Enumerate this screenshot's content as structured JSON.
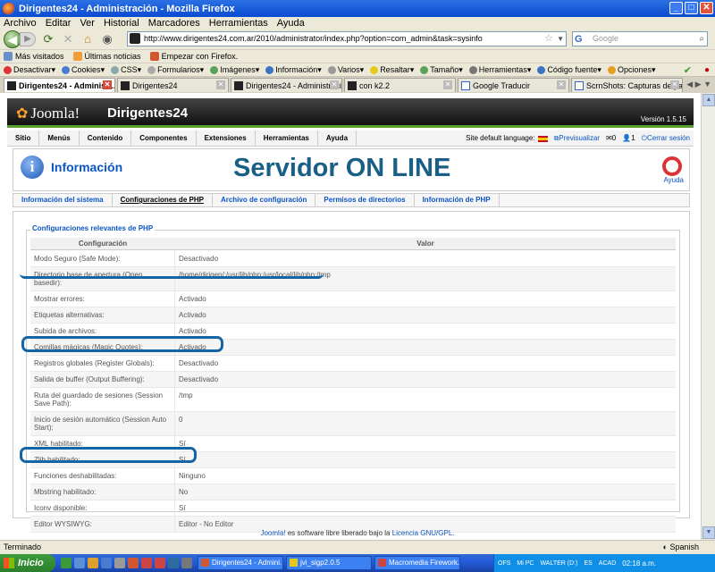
{
  "window": {
    "title": "Dirigentes24 - Administración - Mozilla Firefox"
  },
  "menubar": [
    "Archivo",
    "Editar",
    "Ver",
    "Historial",
    "Marcadores",
    "Herramientas",
    "Ayuda"
  ],
  "navbar": {
    "url": "http://www.dirigentes24.com.ar/2010/administrator/index.php?option=com_admin&task=sysinfo",
    "search_placeholder": "Google"
  },
  "bookmarks": [
    "Más visitados",
    "Últimas noticias",
    "Empezar con Firefox."
  ],
  "devtoolbar": [
    "Desactivar",
    "Cookies",
    "CSS",
    "Formularios",
    "Imágenes",
    "Información",
    "Varios",
    "Resaltar",
    "Tamaño",
    "Herramientas",
    "Código fuente",
    "Opciones"
  ],
  "tabs": [
    {
      "label": "Dirigentes24 - Administr...",
      "active": true
    },
    {
      "label": "Dirigentes24",
      "active": false
    },
    {
      "label": "Dirigentes24 - Administración",
      "active": false
    },
    {
      "label": "con k2.2",
      "active": false
    },
    {
      "label": "Google Traducir",
      "active": false
    },
    {
      "label": "ScrnShots: Capturas de pant...",
      "active": false
    }
  ],
  "joomla": {
    "logo": "Joomla!",
    "site": "Dirigentes24",
    "version": "Versión 1.5.15",
    "menu": [
      "Sitio",
      "Menús",
      "Contenido",
      "Componentes",
      "Extensiones",
      "Herramientas",
      "Ayuda"
    ],
    "status": {
      "lang": "Site default language:",
      "preview": "Previsualizar",
      "msgs": "0",
      "users": "1",
      "logout": "Cerrar sesión"
    },
    "page_title": "Información",
    "banner": "Servidor ON LINE",
    "help": "Ayuda",
    "subtabs": [
      "Información del sistema",
      "Configuraciones de PHP",
      "Archivo de configuración",
      "Permisos de directorios",
      "Información de PHP"
    ],
    "legend": "Configuraciones relevantes de PHP",
    "col_config": "Configuración",
    "col_value": "Valor",
    "rows": [
      {
        "k": "Modo Seguro (Safe Mode):",
        "v": "Desactivado"
      },
      {
        "k": "Directorio base de apertura (Open basedir):",
        "v": "/home/dirigen/:/usr/lib/php:/usr/local/lib/php:/tmp"
      },
      {
        "k": "Mostrar errores:",
        "v": "Activado"
      },
      {
        "k": "Etiquetas alternativas:",
        "v": "Activado"
      },
      {
        "k": "Subida de archivos:",
        "v": "Activado"
      },
      {
        "k": "Comillas mágicas (Magic Quotes):",
        "v": "Activado"
      },
      {
        "k": "Registros globales (Register Globals):",
        "v": "Desactivado"
      },
      {
        "k": "Salida de buffer (Output Buffering):",
        "v": "Desactivado"
      },
      {
        "k": "Ruta del guardado de sesiones (Session Save Path):",
        "v": "/tmp"
      },
      {
        "k": "Inicio de sesión automático (Session Auto Start):",
        "v": "0"
      },
      {
        "k": "XML habilitado:",
        "v": "Sí"
      },
      {
        "k": "Zlib habilitado:",
        "v": "Sí"
      },
      {
        "k": "Funciones deshabilitadas:",
        "v": "Ninguno"
      },
      {
        "k": "Mbstring habilitado:",
        "v": "No"
      },
      {
        "k": "Iconv disponible:",
        "v": "Sí"
      },
      {
        "k": "Editor WYSIWYG:",
        "v": "Editor - No Editor"
      }
    ],
    "footer_link": "Joomla!",
    "footer_text": " es software libre liberado bajo la ",
    "footer_license": "Licencia GNU/GPL."
  },
  "statusbar": {
    "text": "Terminado",
    "lang": "Spanish"
  },
  "taskbar": {
    "start": "Inicio",
    "tasks": [
      "Dirigentes24 - Admini...",
      "jvi_sigp2.0.5",
      "Macromedia Firework..."
    ],
    "tray": [
      "OFS",
      "Mi PC",
      "WALTER (D:)",
      "ES",
      "ACAD"
    ],
    "clock": "02:18 a.m."
  },
  "colors": {
    "joomla_green": "#5a9e2f",
    "link_blue": "#0b55c4",
    "banner_blue": "#1a5f86",
    "highlight": "#1565a6"
  }
}
